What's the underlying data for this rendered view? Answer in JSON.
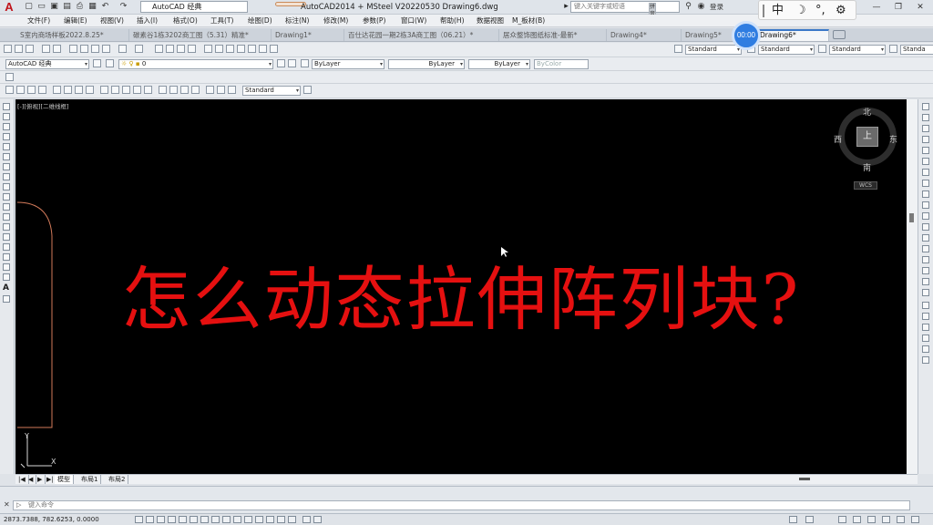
{
  "titlebar": {
    "logo": "A",
    "workspace": "AutoCAD 经典",
    "title": "AutoCAD2014 + MSteel V20220530    Drawing6.dwg",
    "search_placeholder": "键入关键字或短语",
    "login": "登录",
    "minimize": "—",
    "restore": "❐",
    "close": "✕"
  },
  "menu": [
    "文件(F)",
    "编辑(E)",
    "视图(V)",
    "插入(I)",
    "格式(O)",
    "工具(T)",
    "绘图(D)",
    "标注(N)",
    "修改(M)",
    "参数(P)",
    "窗口(W)",
    "帮助(H)",
    "数据视图",
    "M_板材(B)"
  ],
  "tabs": [
    {
      "label": "S室内商场样板2022.8.25*"
    },
    {
      "label": "碳素谷1栋3202商工图（5.31）精准*"
    },
    {
      "label": "Drawing1*"
    },
    {
      "label": "百仕达花园一期2栋3A商工图（06.21）*"
    },
    {
      "label": "居众整饰图纸标准-最新*"
    },
    {
      "label": "Drawing4*"
    },
    {
      "label": "Drawing5*"
    },
    {
      "label": "Drawing6*",
      "active": true
    }
  ],
  "toolbar2": {
    "workspace": "AutoCAD 经典",
    "layer": "0",
    "color": "ByLayer",
    "linetype": "ByLayer",
    "lineweight": "ByLayer",
    "plotstyle": "ByColor",
    "styles": [
      "Standard",
      "Standard",
      "Standard",
      "Standa"
    ]
  },
  "toolbar3": {
    "dimstyle": "Standard"
  },
  "canvas": {
    "viewport_label": "[-][俯视][二维线框]",
    "headline": "怎么动态拉伸阵列块?",
    "compass": {
      "north": "北",
      "south": "南",
      "east": "东",
      "west": "西",
      "center": "上"
    },
    "wcs": "WCS"
  },
  "layout_tabs": [
    "模型",
    "布局1",
    "布局2"
  ],
  "nav_buttons": [
    "|◀",
    "◀",
    "▶",
    "▶|"
  ],
  "command": {
    "placeholder": "键入命令",
    "prefix": "▷"
  },
  "status": {
    "coords": "2873.7388, 782.6253, 0.0000"
  },
  "ime": {
    "items": [
      "中",
      "☽",
      "°,",
      "⚙"
    ]
  },
  "recorder": {
    "time": "00:00"
  },
  "colors": {
    "canvas": "#000000",
    "headline": "#e51010",
    "accent": "#2f7de1"
  }
}
